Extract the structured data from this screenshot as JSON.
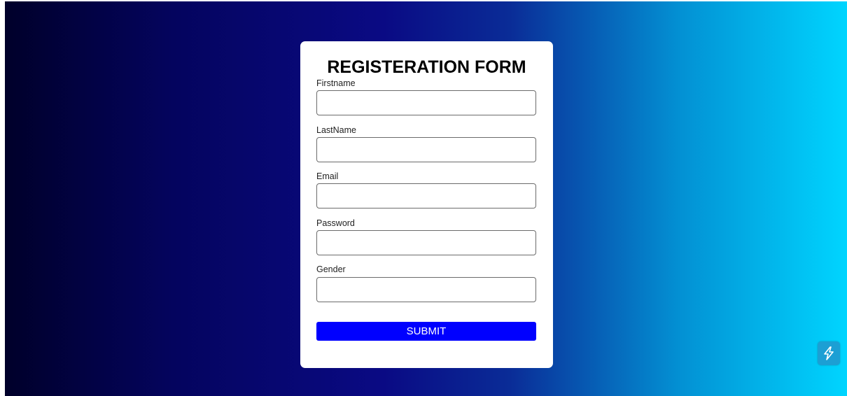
{
  "form": {
    "title": "REGISTERATION FORM",
    "fields": [
      {
        "label": "Firstname",
        "value": "",
        "type": "text"
      },
      {
        "label": "LastName",
        "value": "",
        "type": "text"
      },
      {
        "label": "Email",
        "value": "",
        "type": "email"
      },
      {
        "label": "Password",
        "value": "",
        "type": "password"
      },
      {
        "label": "Gender",
        "value": "",
        "type": "text"
      }
    ],
    "submit_label": "SUBMIT"
  },
  "floating_button": {
    "icon": "lightning-bolt-icon"
  },
  "colors": {
    "background_gradient_start": "#00002a",
    "background_gradient_end": "#00d5ff",
    "submit_button": "#0000ff",
    "card": "#ffffff"
  }
}
